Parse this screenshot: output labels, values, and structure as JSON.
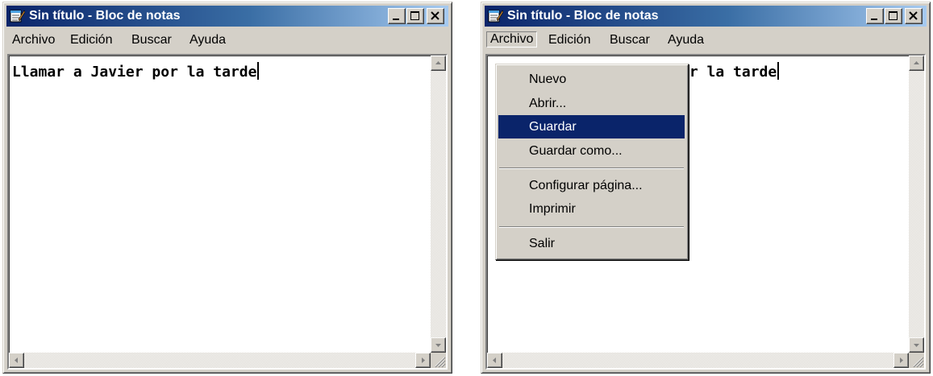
{
  "left_window": {
    "title": "Sin título - Bloc de notas",
    "menu": {
      "archivo": "Archivo",
      "edicion": "Edición",
      "buscar": "Buscar",
      "ayuda": "Ayuda"
    },
    "text": "Llamar a Javier por la tarde"
  },
  "right_window": {
    "title": "Sin título - Bloc de notas",
    "menu": {
      "archivo": "Archivo",
      "edicion": "Edición",
      "buscar": "Buscar",
      "ayuda": "Ayuda"
    },
    "text": "or la tarde",
    "open_menu": "Archivo",
    "dropdown": {
      "items": [
        "Nuevo",
        "Abrir...",
        "Guardar",
        "Guardar como...",
        "Configurar página...",
        "Imprimir",
        "Salir"
      ],
      "highlighted": "Guardar"
    }
  },
  "colors": {
    "title_active_start": "#0a246a",
    "title_active_end": "#a6caf0",
    "menu_highlight": "#0a246a",
    "face": "#d4d0c8"
  },
  "icons": [
    "notepad-icon",
    "minimize-icon",
    "maximize-icon",
    "close-icon",
    "scroll-up-arrow-icon",
    "scroll-down-arrow-icon",
    "scroll-left-arrow-icon",
    "scroll-right-arrow-icon",
    "resize-grip-icon"
  ]
}
